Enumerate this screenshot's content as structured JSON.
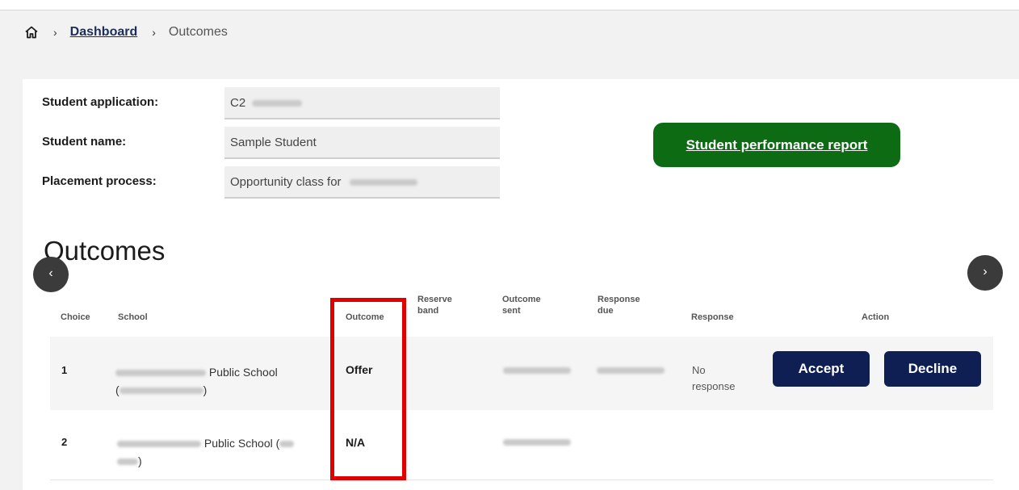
{
  "breadcrumb": {
    "home_icon": "home-icon",
    "separator": "›",
    "dashboard": "Dashboard",
    "current": "Outcomes"
  },
  "student": {
    "application_label": "Student application:",
    "application_value": "C2",
    "name_label": "Student name:",
    "name_value": "Sample Student",
    "process_label": "Placement process:",
    "process_value": "Opportunity class for"
  },
  "report_button": "Student performance report",
  "outcomes": {
    "title": "Outcomes",
    "prev_icon": "chevron-left-icon",
    "next_icon": "chevron-right-icon",
    "prev_glyph": "‹",
    "next_glyph": "›",
    "headers": {
      "choice": "Choice",
      "school": "School",
      "outcome": "Outcome",
      "reserve_band_1": "Reserve",
      "reserve_band_2": "band",
      "outcome_sent_1": "Outcome",
      "outcome_sent_2": "sent",
      "response_due_1": "Response",
      "response_due_2": "due",
      "response": "Response",
      "action": "Action"
    },
    "rows": [
      {
        "choice": "1",
        "school_text": "Public School",
        "school_suffix_open": "(",
        "school_suffix_close": ")",
        "outcome": "Offer",
        "response_1": "No",
        "response_2": "response",
        "accept": "Accept",
        "decline": "Decline"
      },
      {
        "choice": "2",
        "school_text": "Public School (",
        "school_suffix_close": ")",
        "outcome": "N/A"
      }
    ]
  },
  "colors": {
    "report_green": "#0d6b13",
    "action_navy": "#0f1f54",
    "highlight_red": "#e00000"
  }
}
